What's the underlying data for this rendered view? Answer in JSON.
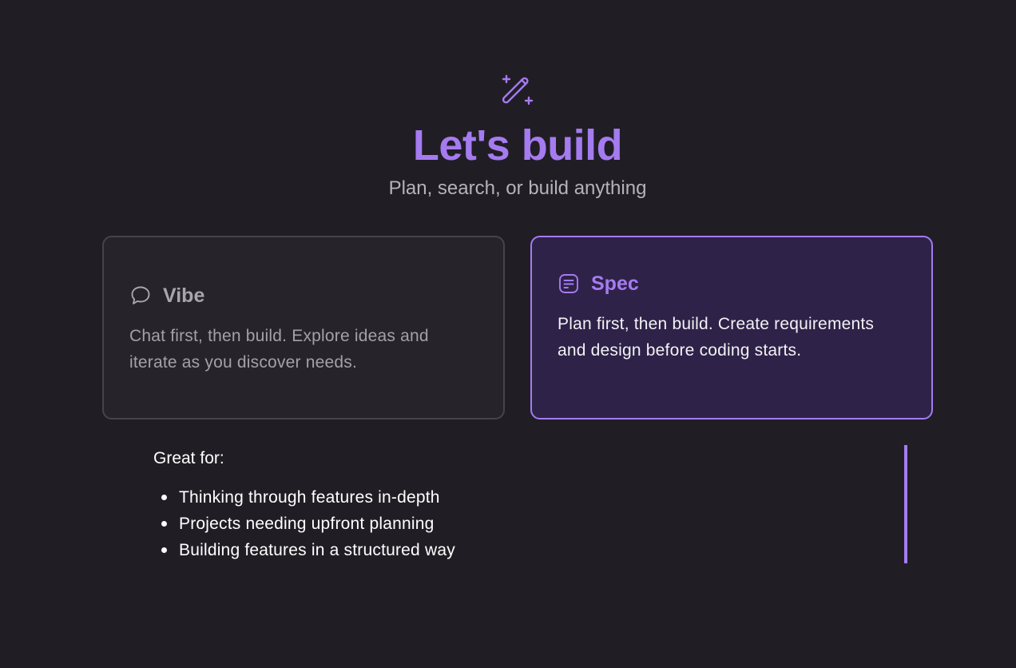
{
  "hero": {
    "icon": "magic-wand-sparkles-icon",
    "title": "Let's build",
    "subtitle": "Plan, search, or build anything"
  },
  "modes": {
    "vibe": {
      "icon": "chat-bubble-icon",
      "label": "Vibe",
      "description": "Chat first, then build. Explore ideas and iterate as you discover needs.",
      "selected": false
    },
    "spec": {
      "icon": "document-lines-icon",
      "label": "Spec",
      "description": "Plan first, then build. Create requirements and design before coding starts.",
      "selected": true
    }
  },
  "details": {
    "heading": "Great for:",
    "items": [
      "Thinking through features in-depth",
      "Projects needing upfront planning",
      "Building features in a structured way"
    ]
  },
  "colors": {
    "background": "#201e24",
    "accent": "#a57bf0",
    "selected_card_bg": "#2e2248",
    "card_bg": "#26242a"
  }
}
